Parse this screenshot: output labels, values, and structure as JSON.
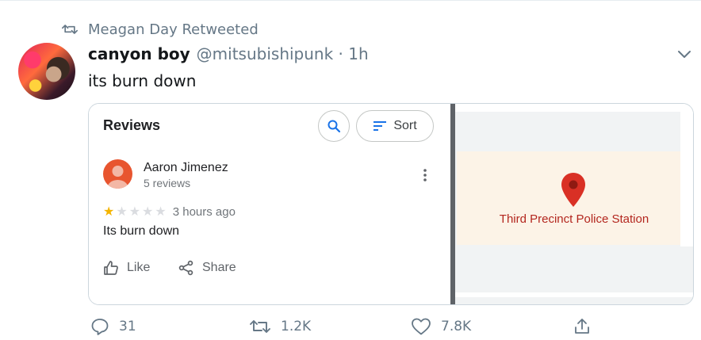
{
  "retweet": {
    "text": "Meagan Day Retweeted"
  },
  "tweet": {
    "name": "canyon boy",
    "handle_time": "@mitsubishipunk · 1h",
    "text": "its burn down"
  },
  "media": {
    "reviews": {
      "title": "Reviews",
      "sort_label": "Sort",
      "reviewer": {
        "name": "Aaron Jimenez",
        "count": "5 reviews"
      },
      "rating": 1,
      "max_rating": 5,
      "time": "3 hours ago",
      "text": "Its burn down",
      "like_label": "Like",
      "share_label": "Share"
    },
    "map": {
      "label": "Third Precinct Police Station"
    }
  },
  "stats": {
    "replies": "31",
    "retweets": "1.2K",
    "likes": "7.8K"
  },
  "colors": {
    "accent": "#1da1f2",
    "muted": "#657786",
    "star": "#f4b400",
    "pin": "#d93025"
  },
  "icons": [
    "retweet-icon",
    "chevron-down-icon",
    "search-icon",
    "sort-icon",
    "more-vert-icon",
    "thumb-up-icon",
    "share-icon",
    "map-pin-icon",
    "reply-icon",
    "heart-icon",
    "upload-icon"
  ]
}
